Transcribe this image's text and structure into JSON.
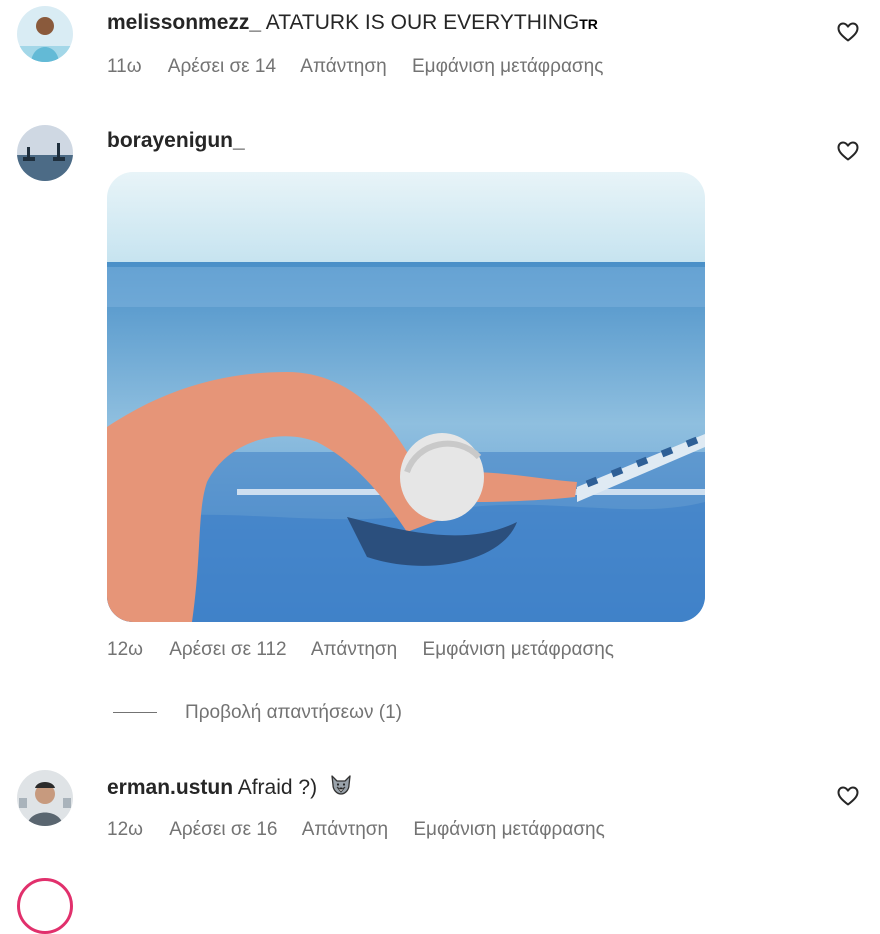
{
  "comments": [
    {
      "username": "melissonmezz_",
      "text": "ATATURK IS OUR EVERYTHING",
      "flag": "TR",
      "age": "11ω",
      "likes": "Αρέσει σε 14",
      "reply": "Απάντηση",
      "translate": "Εμφάνιση μετάφρασης"
    },
    {
      "username": "borayenigun_",
      "age": "12ω",
      "likes": "Αρέσει σε 112",
      "reply": "Απάντηση",
      "translate": "Εμφάνιση μετάφρασης",
      "view_replies": "Προβολή απαντήσεων (1)"
    },
    {
      "username": "erman.ustun",
      "text": "Afraid ?)",
      "emoji_icon": "wolf-face-icon",
      "age": "12ω",
      "likes": "Αρέσει σε 16",
      "reply": "Απάντηση",
      "translate": "Εμφάνιση μετάφρασης"
    }
  ],
  "colors": {
    "text": "#262626",
    "secondary": "#737373",
    "story_ring": "#e1306c"
  },
  "icons": {
    "like": "heart-outline-icon"
  }
}
